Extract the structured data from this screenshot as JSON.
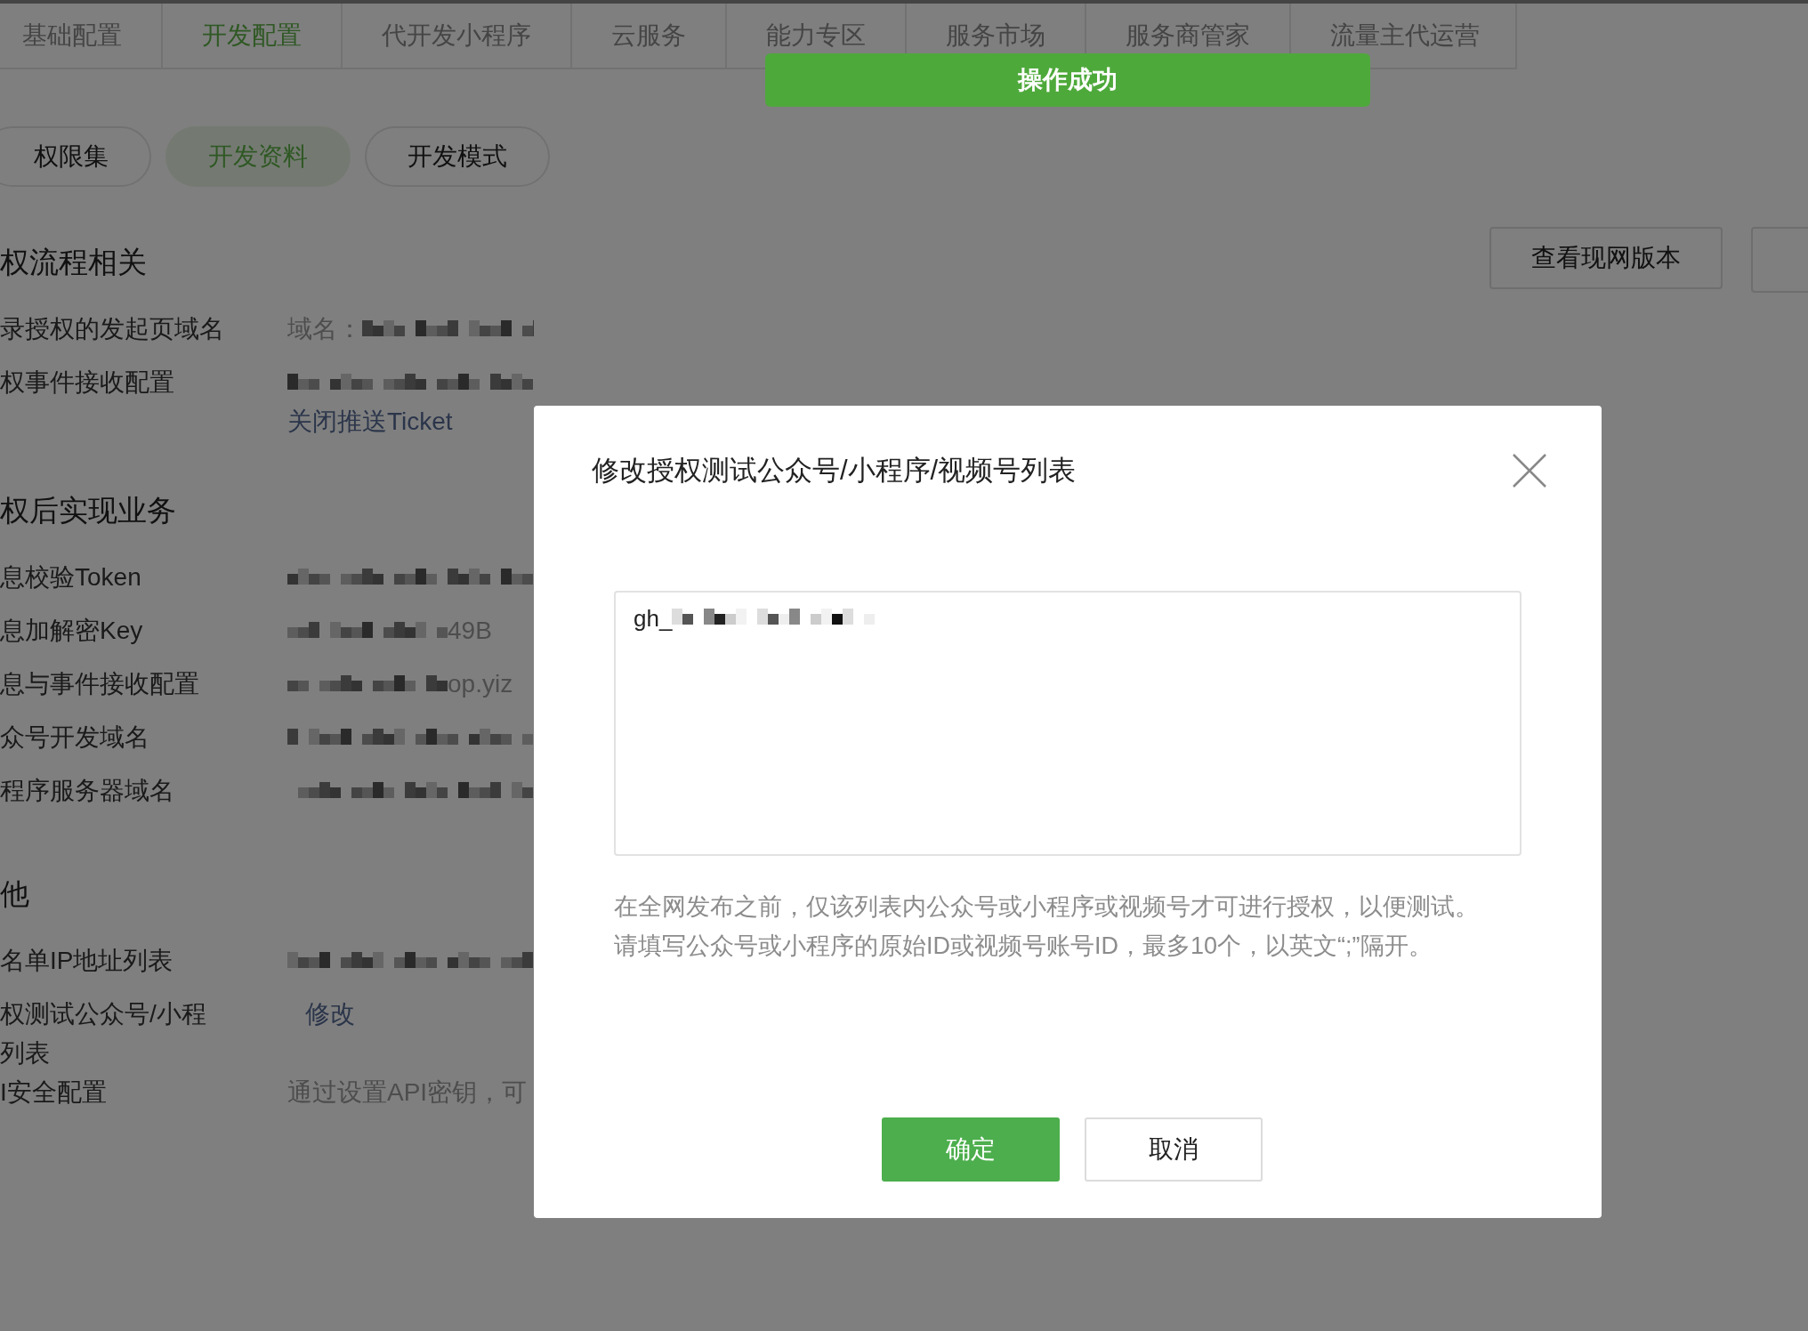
{
  "top_tabs": [
    {
      "label": "基础配置",
      "selected": false
    },
    {
      "label": "开发配置",
      "selected": true
    },
    {
      "label": "代开发小程序",
      "selected": false
    },
    {
      "label": "云服务",
      "selected": false
    },
    {
      "label": "能力专区",
      "selected": false
    },
    {
      "label": "服务市场",
      "selected": false
    },
    {
      "label": "服务商管家",
      "selected": false
    },
    {
      "label": "流量主代运营",
      "selected": false
    }
  ],
  "toast": {
    "text": "操作成功"
  },
  "sub_tabs": [
    {
      "label": "权限集",
      "selected": false
    },
    {
      "label": "开发资料",
      "selected": true
    },
    {
      "label": "开发模式",
      "selected": false
    }
  ],
  "header_buttons": [
    "查看现网版本"
  ],
  "sections": [
    {
      "title": "权流程相关",
      "rows": [
        {
          "label_lines": [
            "录授权的发起页域名"
          ],
          "prefix": "域名：",
          "redacted": true
        },
        {
          "label_lines": [
            "权事件接收配置"
          ],
          "redacted": true,
          "link": "关闭推送Ticket"
        }
      ]
    },
    {
      "title": "权后实现业务",
      "rows": [
        {
          "label_lines": [
            "息校验Token"
          ],
          "redacted": true
        },
        {
          "label_lines": [
            "息加解密Key"
          ],
          "redacted": true,
          "tail": "49B"
        },
        {
          "label_lines": [
            "息与事件接收配置"
          ],
          "redacted": true,
          "tail": "op.yiz"
        },
        {
          "label_lines": [
            "众号开发域名"
          ],
          "redacted": true
        },
        {
          "label_lines": [
            "程序服务器域名"
          ],
          "redacted": true
        }
      ]
    },
    {
      "title": "他",
      "rows": [
        {
          "label_lines": [
            "名单IP地址列表"
          ],
          "redacted": true
        },
        {
          "label_lines": [
            "权测试公众号/小程",
            "列表"
          ],
          "redacted": false,
          "link": "修改"
        },
        {
          "label_lines": [
            "I安全配置"
          ],
          "redacted": false,
          "prefix": "通过设置API密钥，可"
        }
      ]
    }
  ],
  "modal": {
    "title": "修改授权测试公众号/小程序/视频号列表",
    "field": {
      "value": "gh_",
      "redacted": true
    },
    "hints": [
      "在全网发布之前，仅该列表内公众号或小程序或视频号才可进行授权，以便测试。",
      "请填写公众号或小程序的原始ID或视频号账号ID，最多10个，以英文“;”隔开。"
    ],
    "buttons": [
      {
        "label": "确定",
        "kind": "primary"
      },
      {
        "label": "取消",
        "kind": "default"
      }
    ]
  }
}
